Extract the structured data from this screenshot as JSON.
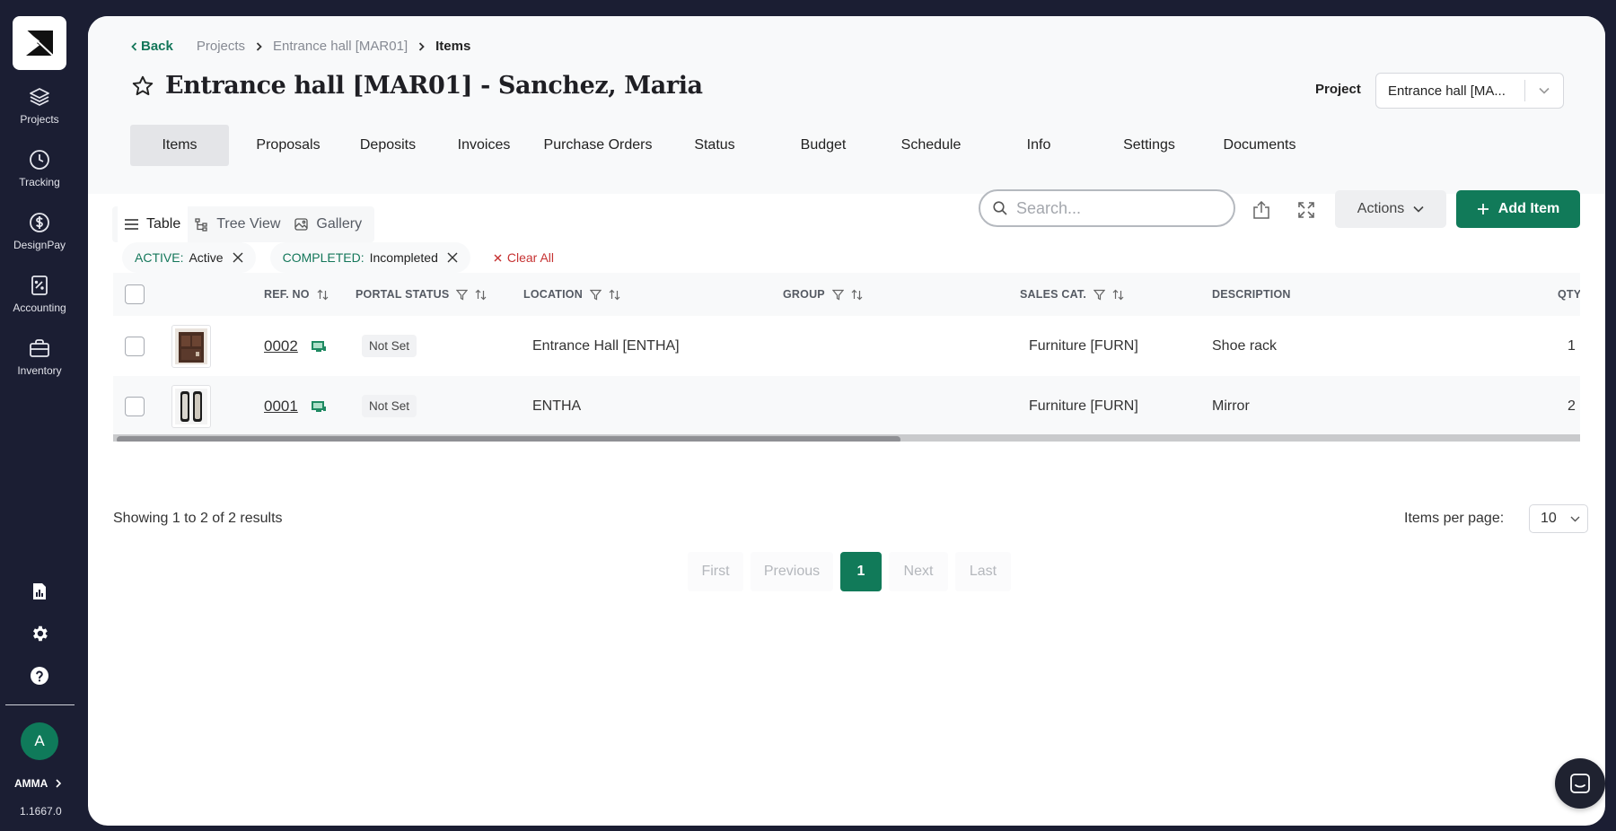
{
  "sidebar": {
    "nav": [
      {
        "label": "Projects",
        "icon": "layers-icon"
      },
      {
        "label": "Tracking",
        "icon": "clock-icon"
      },
      {
        "label": "DesignPay",
        "icon": "dollar-circle-icon"
      },
      {
        "label": "Accounting",
        "icon": "calculator-icon"
      },
      {
        "label": "Inventory",
        "icon": "briefcase-icon"
      }
    ],
    "bottom_icons": [
      "report-icon",
      "gear-icon",
      "help-icon"
    ],
    "avatar_initial": "A",
    "org_name": "AMMA",
    "version": "1.1667.0"
  },
  "breadcrumb": {
    "back": "Back",
    "items": [
      "Projects",
      "Entrance hall [MAR01]"
    ],
    "current": "Items"
  },
  "title": "Entrance hall [MAR01] - Sanchez, Maria",
  "project_selector": {
    "label": "Project",
    "value": "Entrance hall [MA..."
  },
  "tabs": [
    {
      "label": "Items",
      "active": true
    },
    {
      "label": "Proposals"
    },
    {
      "label": "Deposits"
    },
    {
      "label": "Invoices"
    },
    {
      "label": "Purchase Orders"
    },
    {
      "label": "Status"
    },
    {
      "label": "Budget"
    },
    {
      "label": "Schedule"
    },
    {
      "label": "Info"
    },
    {
      "label": "Settings"
    },
    {
      "label": "Documents"
    }
  ],
  "views": [
    {
      "label": "Table",
      "active": true
    },
    {
      "label": "Tree View"
    },
    {
      "label": "Gallery"
    }
  ],
  "search": {
    "placeholder": "Search...",
    "value": ""
  },
  "actions_label": "Actions",
  "add_item_label": "Add Item",
  "filters": [
    {
      "key": "ACTIVE:",
      "value": "Active"
    },
    {
      "key": "COMPLETED:",
      "value": "Incompleted"
    }
  ],
  "clear_all": "Clear All",
  "table": {
    "columns": [
      "REF. NO",
      "PORTAL STATUS",
      "LOCATION",
      "GROUP",
      "SALES CAT.",
      "DESCRIPTION",
      "QTY"
    ],
    "rows": [
      {
        "ref": "0002",
        "status": "Not Set",
        "location": "Entrance Hall [ENTHA]",
        "group": "",
        "sales_cat": "Furniture [FURN]",
        "description": "Shoe rack",
        "qty": "1"
      },
      {
        "ref": "0001",
        "status": "Not Set",
        "location": "ENTHA",
        "group": "",
        "sales_cat": "Furniture [FURN]",
        "description": "Mirror",
        "qty": "2"
      }
    ]
  },
  "results_text": "Showing 1 to 2 of 2 results",
  "items_per_page": {
    "label": "Items per page:",
    "value": "10"
  },
  "pagination": {
    "first": "First",
    "previous": "Previous",
    "current": "1",
    "next": "Next",
    "last": "Last"
  },
  "colors": {
    "sidebar_bg": "#1b1e33",
    "accent": "#117a59",
    "danger": "#c63232"
  }
}
